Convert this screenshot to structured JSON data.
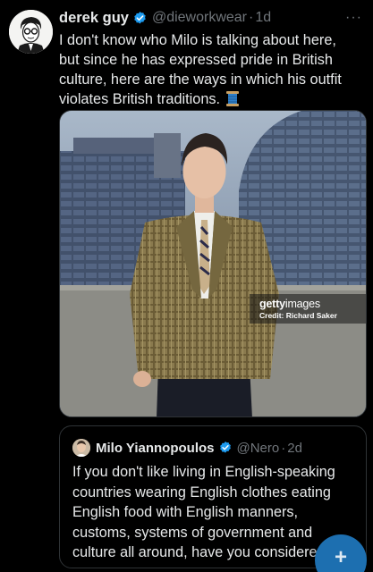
{
  "tweet": {
    "author_name": "derek guy",
    "author_handle": "@dieworkwear",
    "separator": "·",
    "time_ago": "1d",
    "text_lines": [
      "I don't know who Milo is talking about here,",
      "but since he has expressed pride in British",
      "culture, here are the ways in which his outfit",
      "violates British traditions."
    ],
    "emoji_icon": "thread-spool-icon",
    "more_icon": "more-horizontal-icon"
  },
  "media": {
    "watermark_logo": "gettyimages",
    "watermark_credit": "Credit: Richard Saker"
  },
  "quoted_tweet": {
    "author_name": "Milo Yiannopoulos",
    "author_handle": "@Nero",
    "separator": "·",
    "time_ago": "2d",
    "text_lines": [
      "If you don't like living in English-speaking",
      "countries wearing English clothes eating",
      "English food with English manners,",
      "customs, systems of government and",
      "culture all around, have you considered n..."
    ]
  },
  "compose_button": {
    "icon": "plus-icon",
    "label": "+"
  },
  "colors": {
    "background": "#000000",
    "text_primary": "#e7e9ea",
    "text_secondary": "#71767b",
    "verified_blue": "#1d9bf0",
    "fab_blue": "#1d6fb0",
    "border": "#2f3336"
  }
}
